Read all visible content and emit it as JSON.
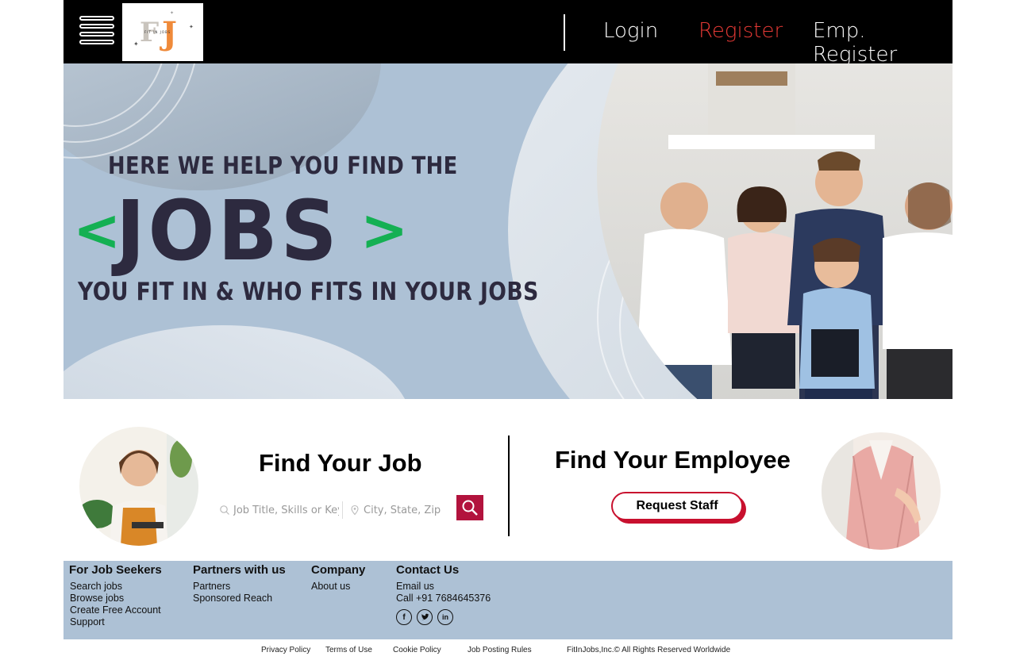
{
  "header": {
    "logo_text": "FIT IN JOBS",
    "logo_monogram": "FJ",
    "nav": {
      "login": "Login",
      "register": "Register",
      "emp_register": "Emp. Register"
    }
  },
  "hero": {
    "line1": "HERE WE HELP YOU FIND THE",
    "bracket_left": "<",
    "big_word": "JOBS",
    "bracket_right": ">",
    "line2": "YOU FIT IN & WHO FITS IN YOUR JOBS"
  },
  "find_job": {
    "title": "Find Your Job",
    "keyword_placeholder": "Job Title, Skills or Keywords",
    "location_placeholder": "City, State, Zip Code"
  },
  "find_employee": {
    "title": "Find Your Employee",
    "button": "Request Staff"
  },
  "footer": {
    "columns": [
      {
        "heading": "For Job Seekers",
        "links": [
          "Search jobs",
          "Browse jobs",
          "Create Free Account",
          "Support"
        ]
      },
      {
        "heading": "Partners with us",
        "links": [
          "Partners",
          "Sponsored Reach"
        ]
      },
      {
        "heading": "Company",
        "links": [
          "About us"
        ]
      },
      {
        "heading": "Contact Us",
        "links": [
          "Email us",
          "Call +91 7684645376"
        ]
      }
    ],
    "socials": [
      "facebook-icon",
      "twitter-icon",
      "linkedin-icon"
    ]
  },
  "bottom": {
    "privacy": "Privacy Policy",
    "terms": "Terms of Use",
    "cookie": "Cookie Policy",
    "posting_rules": "Job Posting Rules",
    "copyright": "FitInJobs,Inc.© All Rights Reserved Worldwide"
  },
  "colors": {
    "header_bg": "#000000",
    "register_accent": "#e53935",
    "hero_bg": "#adc1d5",
    "hero_text": "#2d2a3f",
    "bracket_green": "#14b053",
    "search_button": "#b2133d",
    "request_shadow": "#c8102e",
    "footer_bg": "#adc1d5"
  }
}
